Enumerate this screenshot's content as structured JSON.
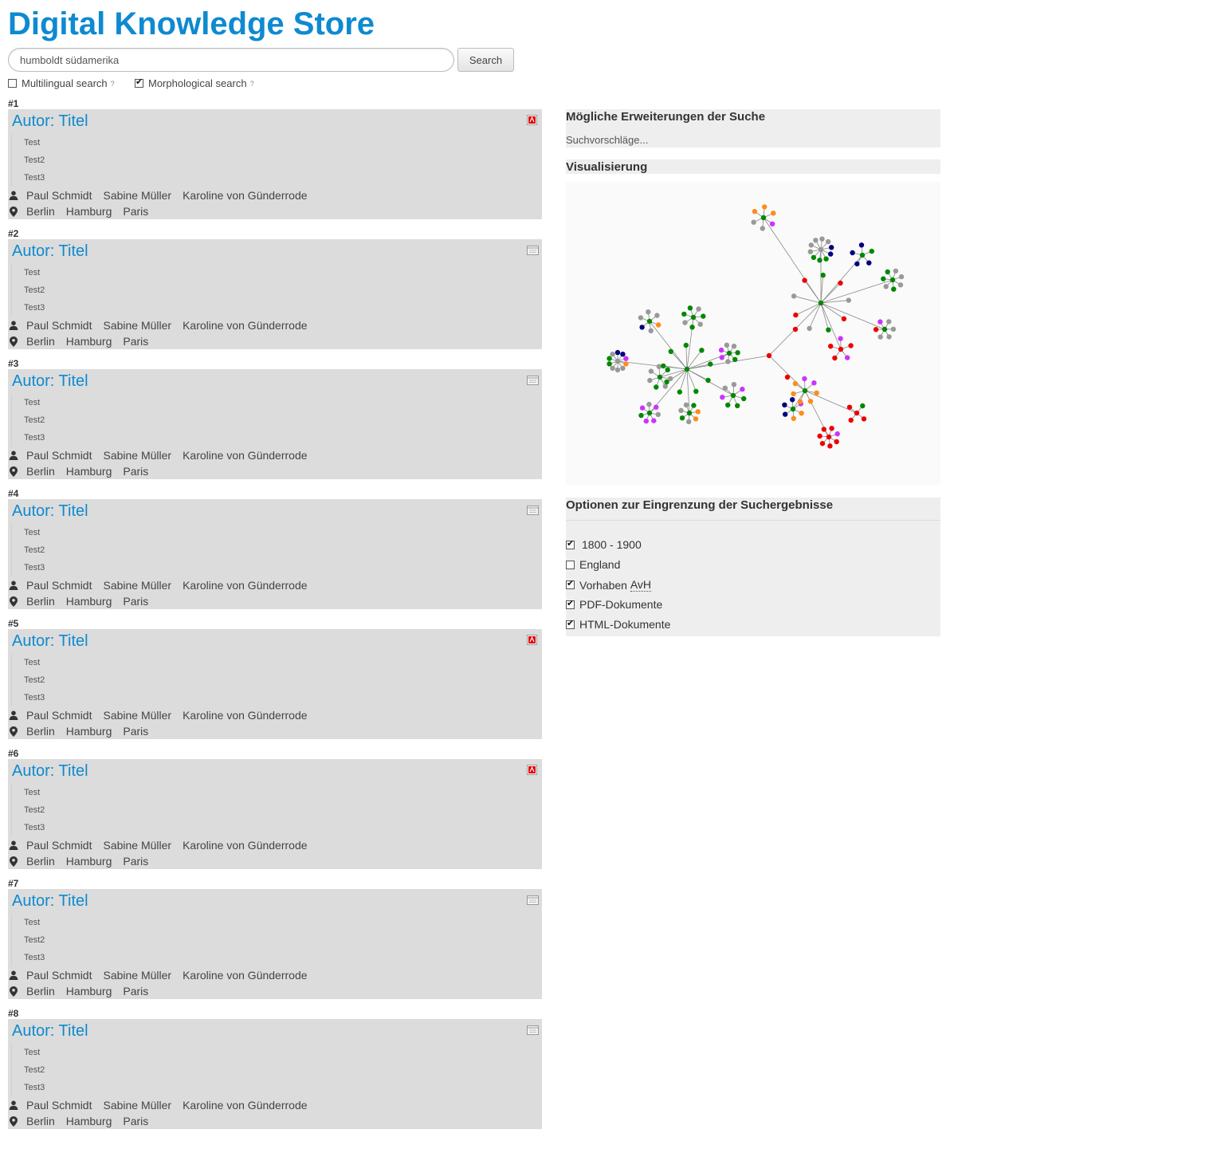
{
  "header": {
    "title": "Digital Knowledge Store"
  },
  "search": {
    "value": "humboldt südamerika",
    "button_label": "Search"
  },
  "options": [
    {
      "label": "Multilingual search",
      "checked": false,
      "marker": "?"
    },
    {
      "label": "Morphological search",
      "checked": true,
      "marker": "?"
    }
  ],
  "results": [
    {
      "rank": "#1",
      "title": "Autor: Titel",
      "doctype": "pdf",
      "snippets": [
        "Test",
        "Test2",
        "Test3"
      ],
      "persons": [
        "Paul Schmidt",
        "Sabine Müller",
        "Karoline von Günderrode"
      ],
      "places": [
        "Berlin",
        "Hamburg",
        "Paris"
      ]
    },
    {
      "rank": "#2",
      "title": "Autor: Titel",
      "doctype": "html",
      "snippets": [
        "Test",
        "Test2",
        "Test3"
      ],
      "persons": [
        "Paul Schmidt",
        "Sabine Müller",
        "Karoline von Günderrode"
      ],
      "places": [
        "Berlin",
        "Hamburg",
        "Paris"
      ]
    },
    {
      "rank": "#3",
      "title": "Autor: Titel",
      "doctype": "html",
      "snippets": [
        "Test",
        "Test2",
        "Test3"
      ],
      "persons": [
        "Paul Schmidt",
        "Sabine Müller",
        "Karoline von Günderrode"
      ],
      "places": [
        "Berlin",
        "Hamburg",
        "Paris"
      ]
    },
    {
      "rank": "#4",
      "title": "Autor: Titel",
      "doctype": "html",
      "snippets": [
        "Test",
        "Test2",
        "Test3"
      ],
      "persons": [
        "Paul Schmidt",
        "Sabine Müller",
        "Karoline von Günderrode"
      ],
      "places": [
        "Berlin",
        "Hamburg",
        "Paris"
      ]
    },
    {
      "rank": "#5",
      "title": "Autor: Titel",
      "doctype": "pdf",
      "snippets": [
        "Test",
        "Test2",
        "Test3"
      ],
      "persons": [
        "Paul Schmidt",
        "Sabine Müller",
        "Karoline von Günderrode"
      ],
      "places": [
        "Berlin",
        "Hamburg",
        "Paris"
      ]
    },
    {
      "rank": "#6",
      "title": "Autor: Titel",
      "doctype": "pdf",
      "snippets": [
        "Test",
        "Test2",
        "Test3"
      ],
      "persons": [
        "Paul Schmidt",
        "Sabine Müller",
        "Karoline von Günderrode"
      ],
      "places": [
        "Berlin",
        "Hamburg",
        "Paris"
      ]
    },
    {
      "rank": "#7",
      "title": "Autor: Titel",
      "doctype": "html",
      "snippets": [
        "Test",
        "Test2",
        "Test3"
      ],
      "persons": [
        "Paul Schmidt",
        "Sabine Müller",
        "Karoline von Günderrode"
      ],
      "places": [
        "Berlin",
        "Hamburg",
        "Paris"
      ]
    },
    {
      "rank": "#8",
      "title": "Autor: Titel",
      "doctype": "html",
      "snippets": [
        "Test",
        "Test2",
        "Test3"
      ],
      "persons": [
        "Paul Schmidt",
        "Sabine Müller",
        "Karoline von Günderrode"
      ],
      "places": [
        "Berlin",
        "Hamburg",
        "Paris"
      ]
    }
  ],
  "suggestions": {
    "heading": "Mögliche Erweiterungen der Suche",
    "text": "Suchvorschläge..."
  },
  "visualization": {
    "heading": "Visualisierung",
    "node_colors": [
      "#008800",
      "#999999",
      "#ee0000",
      "#ff8c1a",
      "#cc33ff",
      "#000080",
      "#ffff00",
      "#000000"
    ]
  },
  "filters": {
    "heading": "Optionen zur Eingrenzung der Suchergebnisse",
    "items": [
      {
        "label": "1800 - 1900",
        "checked": true
      },
      {
        "label": "England",
        "checked": false
      },
      {
        "label_pre": "Vorhaben ",
        "abbr": "AvH",
        "checked": true
      },
      {
        "label": "PDF-Dokumente",
        "checked": true
      },
      {
        "label": "HTML-Dokumente",
        "checked": true
      }
    ]
  },
  "colors": {
    "accent": "#0e8ad0",
    "card_bg": "#dcdcdc",
    "panel_bg": "#eeeeee"
  }
}
